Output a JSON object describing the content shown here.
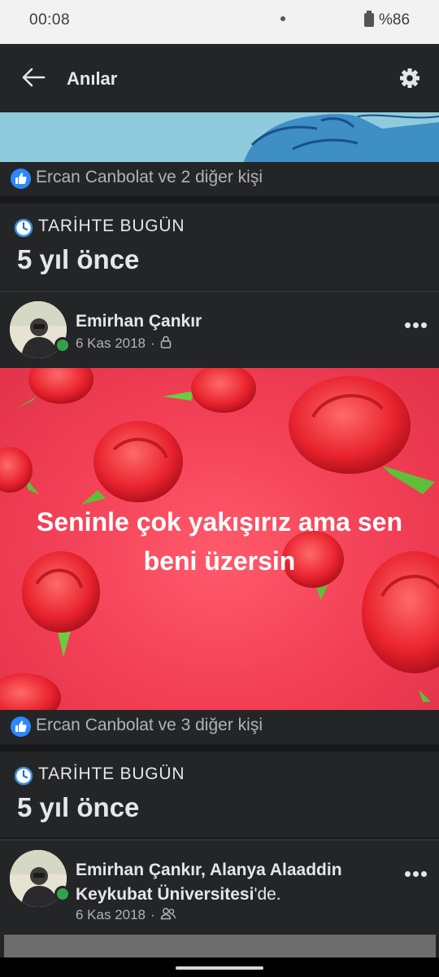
{
  "status_bar": {
    "time": "00:08",
    "battery": "%86"
  },
  "header": {
    "title": "Anılar"
  },
  "reactions": [
    {
      "text": "Ercan Canbolat ve 2 diğer kişi"
    },
    {
      "text": "Ercan Canbolat ve 3 diğer kişi"
    }
  ],
  "memories": [
    {
      "label": "TARİHTE BUGÜN",
      "years": "5 yıl önce",
      "post": {
        "author": "Emirhan Çankır",
        "date": "6 Kas 2018",
        "separator": "·",
        "privacy_icon": "lock-icon",
        "text": "Seninle çok yakışırız ama sen beni üzersin"
      }
    },
    {
      "label": "TARİHTE BUGÜN",
      "years": "5 yıl önce",
      "post": {
        "author_line1": "Emirhan Çankır, Alanya Alaaddin",
        "author_line2": "Keykubat Üniversitesi",
        "author_suffix": "'de.",
        "date": "6 Kas 2018",
        "separator": "·",
        "privacy_icon": "friends-icon"
      }
    }
  ],
  "colors": {
    "background": "#18191a",
    "card": "#242526",
    "accent": "#2d88ff",
    "online": "#31a24c",
    "post_background": "#f23f55"
  }
}
